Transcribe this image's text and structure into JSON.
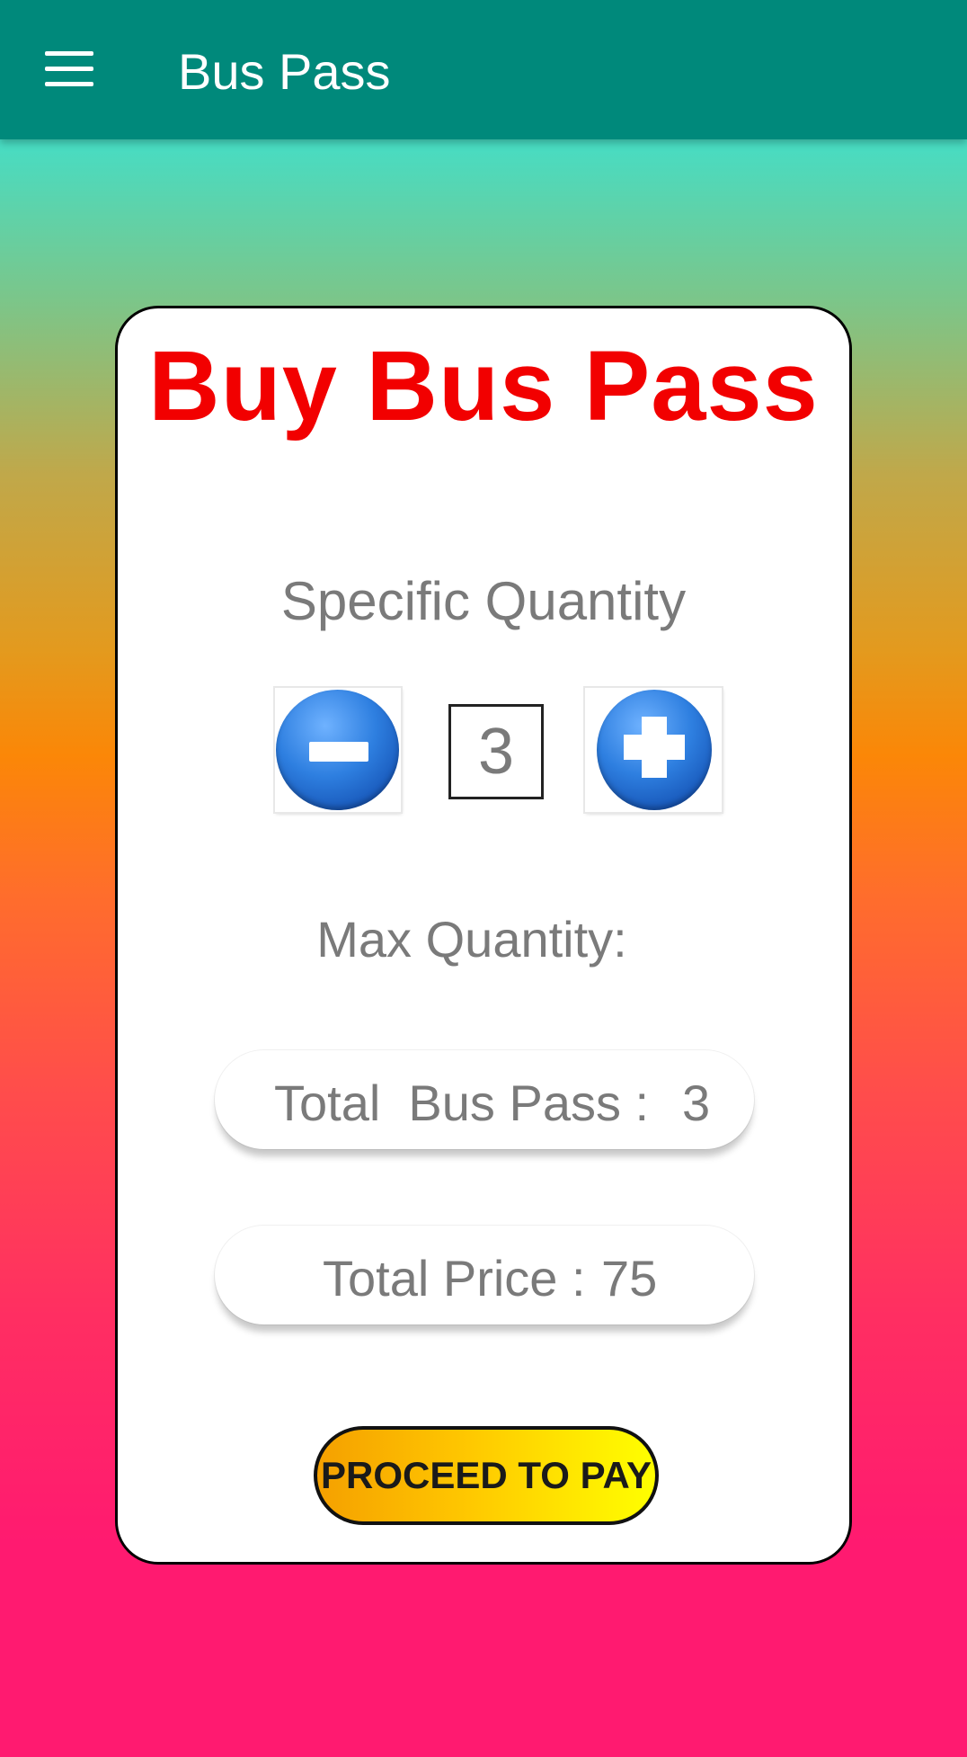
{
  "appbar": {
    "title": "Bus Pass",
    "menu_icon": "menu-icon",
    "background": "#00897b"
  },
  "card": {
    "title": "Buy Bus Pass",
    "title_color": "#f20000",
    "specific_quantity_label": "Specific Quantity",
    "stepper": {
      "decrement_icon": "minus-circle-icon",
      "increment_icon": "plus-circle-icon",
      "value": "3"
    },
    "max_quantity_label": "Max Quantity:",
    "total_bus_pass": {
      "label": "Total  Bus Pass :",
      "value": "3"
    },
    "total_price": {
      "label": "Total Price :",
      "value": "75"
    },
    "pay_button_label": "PROCEED TO PAY"
  },
  "colors": {
    "icon_blue": "#2e7fe0",
    "pay_button_start": "#f5a000",
    "pay_button_end": "#ffff00",
    "text_gray": "#7a7a7a"
  }
}
